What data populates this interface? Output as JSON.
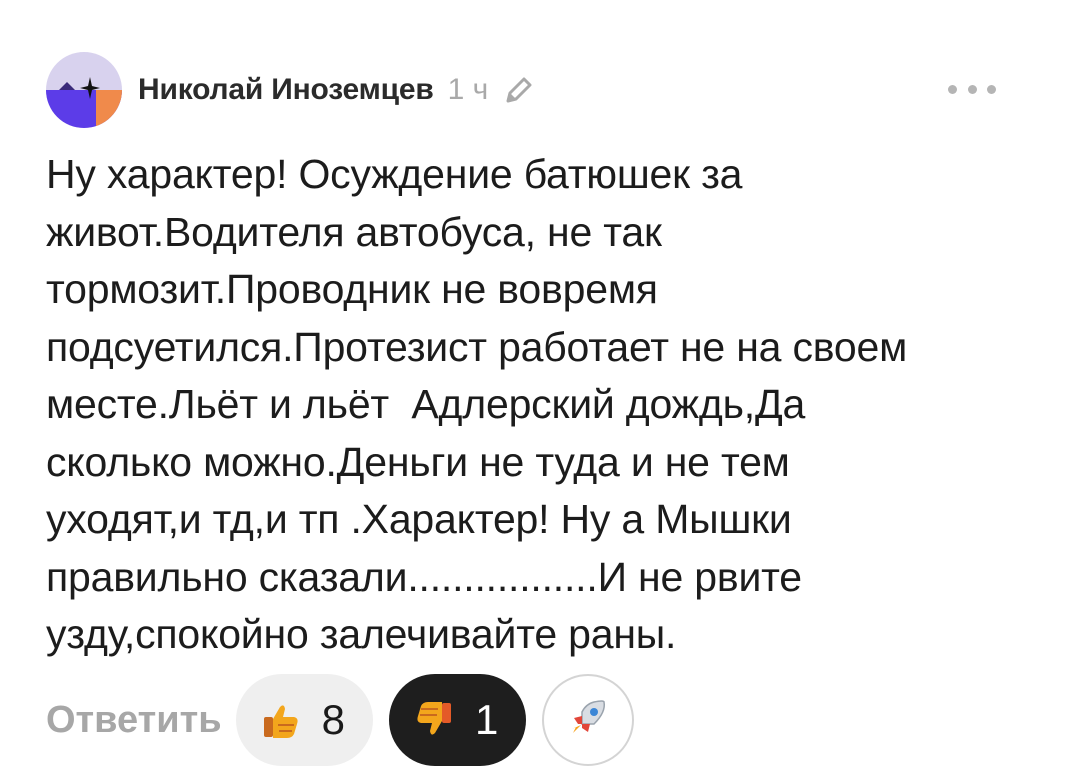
{
  "comment": {
    "author": "Николай Иноземцев",
    "time": "1 ч",
    "text": "Ну характер! Осуждение батюшек за\nживот.Водителя автобуса, не так\nтормозит.Проводник не вовремя\nподсуетился.Протезист работает не на своем\nместе.Льёт и льёт  Адлерский дождь,Да\nсколько можно.Деньги не туда и не тем\nуходят,и тд,и тп .Характер! Ну а Мышки\nправильно сказали.................И не рвите\nузду,спокойно залечивайте раны."
  },
  "actions": {
    "reply_label": "Ответить",
    "likes": "8",
    "dislikes": "1"
  },
  "icons": {
    "avatar": "avatar-image",
    "edit": "pencil-icon",
    "more": "more-dots-icon",
    "like": "thumbs-up-icon",
    "dislike": "thumbs-down-icon",
    "boost": "rocket-icon"
  },
  "colors": {
    "avatar_top": "#d8d2ee",
    "avatar_bottom": "#5c3ce8",
    "avatar_corner": "#f08a4b",
    "reply": "#a7a7a7",
    "dislike_bg": "#1e1e1e",
    "like_bg": "#efefef"
  }
}
